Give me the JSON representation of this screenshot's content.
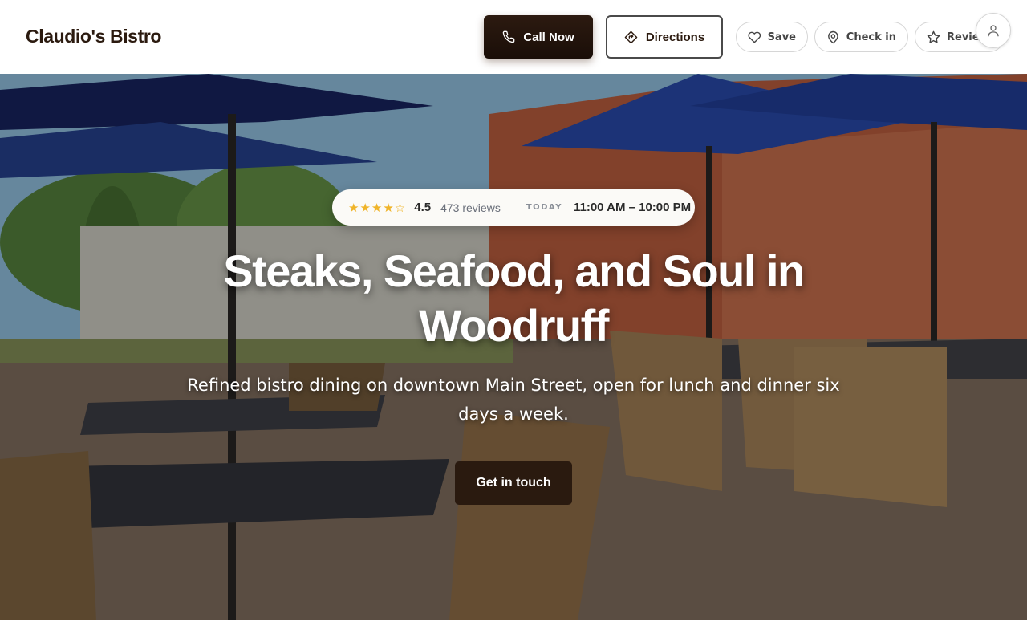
{
  "header": {
    "brand": "Claudio's Bistro",
    "call_label": "Call Now",
    "directions_label": "Directions",
    "save_label": "Save",
    "checkin_label": "Check in",
    "review_label": "Review"
  },
  "hero": {
    "stars_text": "★★★★☆",
    "rating": "4.5",
    "reviews": "473 reviews",
    "today_label": "TODAY",
    "hours": "11:00 AM – 10:00 PM",
    "headline": "Steaks, Seafood, and Soul in Woodruff",
    "subheadline": "Refined bistro dining on downtown Main Street, open for lunch and dinner six days a week.",
    "cta_label": "Get in touch"
  },
  "icons": {
    "call": "phone-icon",
    "directions": "directions-icon",
    "save": "heart-icon",
    "checkin": "map-pin-icon",
    "review": "star-icon",
    "account": "user-icon"
  },
  "colors": {
    "brand_dark": "#2a1a0f",
    "star": "#f0b429",
    "hero_text": "#ffffff"
  }
}
